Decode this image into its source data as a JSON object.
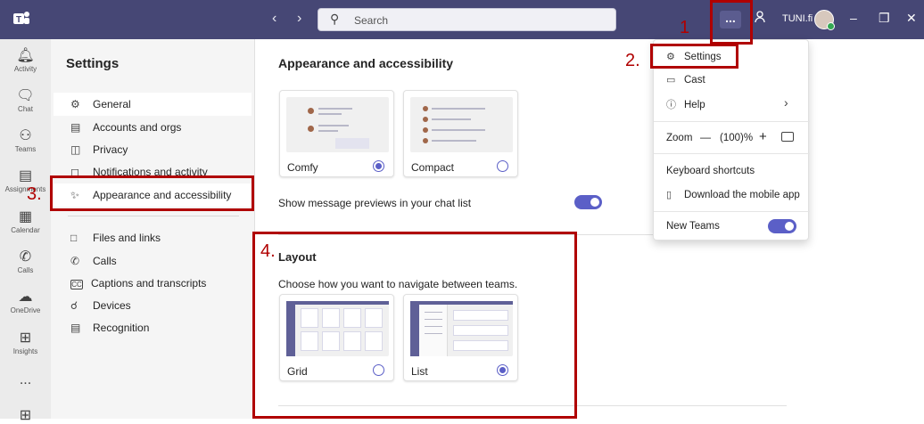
{
  "colors": {
    "titlebar": "#464775",
    "accent": "#5b5fc7",
    "annotation": "#b00000"
  },
  "titlebar": {
    "search_placeholder": "Search",
    "org_name": "TUNI.fi",
    "more_label": "..."
  },
  "rail": [
    {
      "label": "Activity",
      "icon": "bell-icon"
    },
    {
      "label": "Chat",
      "icon": "chat-icon"
    },
    {
      "label": "Teams",
      "icon": "teams-icon"
    },
    {
      "label": "Assignments",
      "icon": "assignments-icon"
    },
    {
      "label": "Calendar",
      "icon": "calendar-icon"
    },
    {
      "label": "Calls",
      "icon": "phone-icon"
    },
    {
      "label": "OneDrive",
      "icon": "cloud-icon"
    },
    {
      "label": "Insights",
      "icon": "insights-icon"
    },
    {
      "label": "...",
      "icon": "more-icon"
    }
  ],
  "settings": {
    "title": "Settings",
    "items": [
      {
        "label": "General",
        "icon": "gear-icon"
      },
      {
        "label": "Accounts and orgs",
        "icon": "id-card-icon"
      },
      {
        "label": "Privacy",
        "icon": "lock-icon"
      },
      {
        "label": "Notifications and activity",
        "icon": "bell-icon"
      },
      {
        "label": "Appearance and accessibility",
        "icon": "wand-icon"
      },
      {
        "label": "Files and links",
        "icon": "file-icon"
      },
      {
        "label": "Calls",
        "icon": "phone-icon"
      },
      {
        "label": "Captions and transcripts",
        "icon": "cc-icon"
      },
      {
        "label": "Devices",
        "icon": "devices-icon"
      },
      {
        "label": "Recognition",
        "icon": "recognition-icon"
      }
    ]
  },
  "main": {
    "title": "Appearance and accessibility",
    "density_options": [
      {
        "label": "Comfy",
        "selected": true
      },
      {
        "label": "Compact",
        "selected": false
      }
    ],
    "message_preview_label": "Show message previews in your chat list",
    "message_preview_on": true,
    "layout_title": "Layout",
    "layout_desc": "Choose how you want to navigate between teams.",
    "layout_options": [
      {
        "label": "Grid",
        "selected": false
      },
      {
        "label": "List",
        "selected": true
      }
    ]
  },
  "dropdown": {
    "settings": "Settings",
    "cast": "Cast",
    "help": "Help",
    "zoom_label": "Zoom",
    "zoom_minus": "—",
    "zoom_value": "(100)%",
    "zoom_plus": "+",
    "keyboard_shortcuts": "Keyboard shortcuts",
    "download_mobile": "Download the mobile app",
    "new_teams": "New Teams",
    "new_teams_on": true
  },
  "annotations": {
    "a1": "1",
    "a2": "2.",
    "a3": "3.",
    "a4": "4."
  }
}
